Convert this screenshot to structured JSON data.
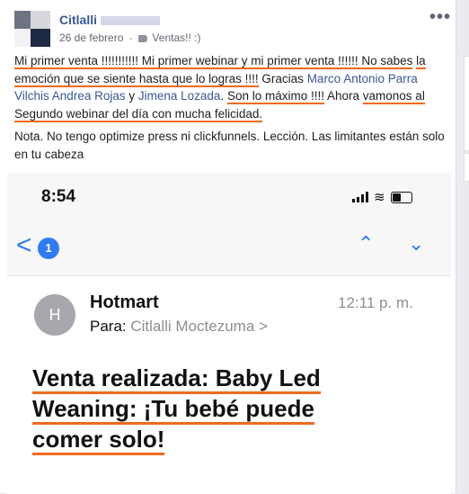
{
  "post": {
    "author": "Citlalli",
    "date": "26 de febrero",
    "separator": "·",
    "audience": "Ventas!! :)",
    "more": "•••",
    "text": {
      "p1_a": "Mi primer venta !!!!!!!!!!! Mi primer webinar y mi primer venta !!!!!! No sabes",
      "p1_b": "la emoción que se siente hasta que lo logras !!!!",
      "p1_c": " Gracias ",
      "mention1": "Marco Antonio Parra Vilchis",
      "mention2": "Andrea Rojas",
      "p1_y": " y ",
      "mention3": "Jimena Lozada",
      "p1_d": ". ",
      "p1_e": "Son lo máximo !!!!",
      "p1_f": " Ahora ",
      "p1_g": "vamonos al Segundo webinar del día con mucha felicidad.",
      "p2": "Nota. No tengo optimize press ni clickfunnels. Lección. Las limitantes están solo en tu cabeza"
    }
  },
  "screenshot": {
    "time": "8:54",
    "back_glyph": "<",
    "badge": "1",
    "up_arrow": "⌃",
    "down_arrow": "⌄",
    "wifi": "≋",
    "avatar_letter": "H",
    "sender": "Hotmart",
    "to_label": "Para:",
    "to_name": "Citlalli Moctezuma >",
    "mail_time": "12:11 p. m.",
    "subject": {
      "l1": "Venta realizada: Baby Led",
      "l2": "Weaning: ¡Tu bebé puede",
      "l3": "comer solo!"
    }
  },
  "colors": {
    "accent": "#f06a1e",
    "link": "#385898",
    "ios_blue": "#2f7bf6"
  }
}
